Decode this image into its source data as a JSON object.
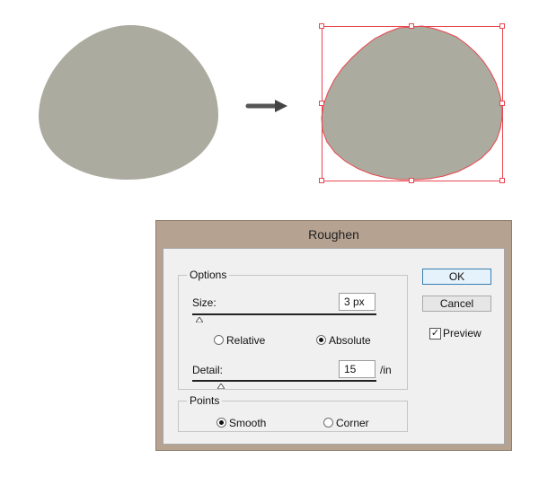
{
  "dialog": {
    "title": "Roughen",
    "options": {
      "legend": "Options",
      "size_label": "Size:",
      "size_value": "3 px",
      "relative_label": "Relative",
      "absolute_label": "Absolute",
      "selected_mode": "Absolute",
      "detail_label": "Detail:",
      "detail_value": "15",
      "detail_unit": "/in"
    },
    "points": {
      "legend": "Points",
      "smooth_label": "Smooth",
      "corner_label": "Corner",
      "selected": "Smooth"
    },
    "ok_label": "OK",
    "cancel_label": "Cancel",
    "preview_label": "Preview",
    "preview_checked": true
  },
  "colors": {
    "shape_fill": "#abab9f",
    "selection": "#e8474f",
    "dialog_frame": "#b5a291"
  }
}
